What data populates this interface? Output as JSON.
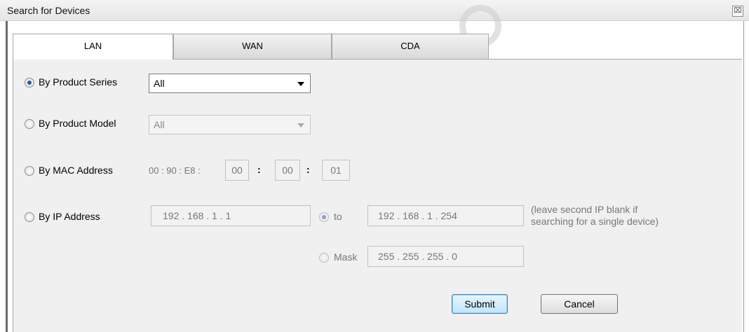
{
  "window": {
    "title": "Search for Devices",
    "close_glyph": "⌧"
  },
  "tabs": [
    {
      "label": "LAN",
      "active": true
    },
    {
      "label": "WAN",
      "active": false
    },
    {
      "label": "CDA",
      "active": false
    }
  ],
  "search": {
    "product_series": {
      "label": "By Product Series",
      "selected": true,
      "value": "All"
    },
    "product_model": {
      "label": "By Product Model",
      "selected": false,
      "value": "All"
    },
    "mac": {
      "label": "By MAC Address",
      "prefix": "00 : 90 : E8 :",
      "octets": [
        "00",
        "00",
        "01"
      ],
      "sep": ":"
    },
    "ip": {
      "label": "By IP Address",
      "from": "192  .  168  .   1   .   1",
      "to_label": "to",
      "to": "192  .  168  .   1   . 254",
      "hint_line1": "(leave second IP blank if",
      "hint_line2": "searching for a single device)",
      "mask_label": "Mask",
      "mask": "255  . 255  . 255  .   0"
    }
  },
  "buttons": {
    "submit": "Submit",
    "cancel": "Cancel"
  }
}
